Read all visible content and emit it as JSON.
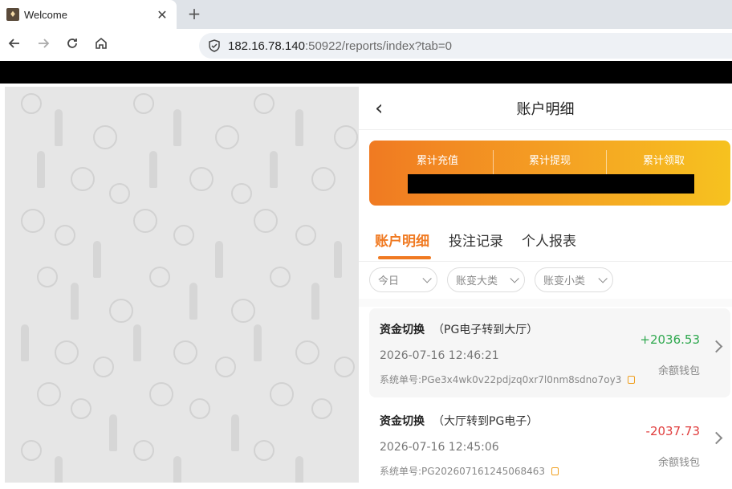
{
  "browser": {
    "tab_title": "Welcome",
    "new_tab": "+",
    "close_tab": "✕",
    "url_host": "182.16.78.140",
    "url_rest": ":50922/reports/index?tab=0"
  },
  "header": {
    "title": "账户明细"
  },
  "summary": {
    "items": [
      {
        "label": "累计充值"
      },
      {
        "label": "累计提现"
      },
      {
        "label": "累计领取"
      }
    ]
  },
  "tabs": [
    {
      "label": "账户明细",
      "active": true
    },
    {
      "label": "投注记录",
      "active": false
    },
    {
      "label": "个人报表",
      "active": false
    }
  ],
  "filters": [
    {
      "label": "今日"
    },
    {
      "label": "账变大类"
    },
    {
      "label": "账变小类"
    }
  ],
  "records": [
    {
      "type": "资金切换",
      "detail": "（PG电子转到大厅）",
      "time": "2026-07-16 12:46:21",
      "order_label": "系统单号:",
      "order_no": "PGe3x4wk0v22pdjzq0xr7l0nm8sdno7oy3",
      "amount": "+2036.53",
      "wallet": "余额钱包"
    },
    {
      "type": "资金切换",
      "detail": "（大厅转到PG电子）",
      "time": "2026-07-16 12:45:06",
      "order_label": "系统单号:",
      "order_no": "PG202607161245068463",
      "amount": "-2037.73",
      "wallet": "余额钱包"
    }
  ],
  "colors": {
    "accent": "#f07a22",
    "positive": "#2fa84f",
    "negative": "#e03c3c"
  }
}
